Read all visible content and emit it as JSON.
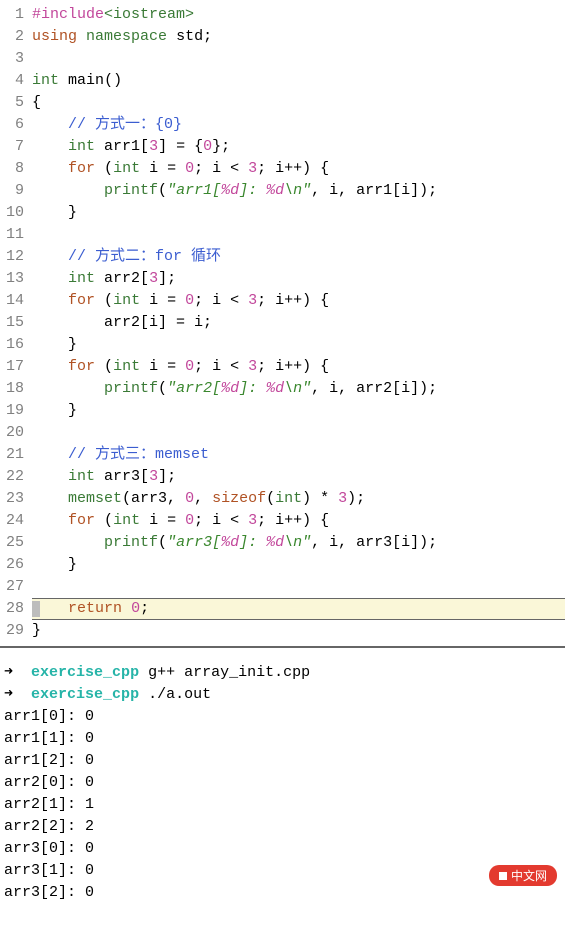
{
  "code": {
    "lines": [
      {
        "n": "1",
        "tokens": [
          [
            "pp",
            "#include"
          ],
          [
            "hdr",
            "<iostream>"
          ]
        ]
      },
      {
        "n": "2",
        "tokens": [
          [
            "kw",
            "using"
          ],
          [
            "op",
            " "
          ],
          [
            "type",
            "namespace"
          ],
          [
            "op",
            " "
          ],
          [
            "id",
            "std"
          ],
          [
            "op",
            ";"
          ]
        ]
      },
      {
        "n": "3",
        "tokens": []
      },
      {
        "n": "4",
        "tokens": [
          [
            "type",
            "int"
          ],
          [
            "op",
            " "
          ],
          [
            "id",
            "main"
          ],
          [
            "op",
            "()"
          ]
        ]
      },
      {
        "n": "5",
        "tokens": [
          [
            "op",
            "{"
          ]
        ]
      },
      {
        "n": "6",
        "tokens": [
          [
            "op",
            "    "
          ],
          [
            "cm",
            "// 方式一：{0}"
          ]
        ]
      },
      {
        "n": "7",
        "tokens": [
          [
            "op",
            "    "
          ],
          [
            "type",
            "int"
          ],
          [
            "op",
            " arr1["
          ],
          [
            "num",
            "3"
          ],
          [
            "op",
            "] = {"
          ],
          [
            "num",
            "0"
          ],
          [
            "op",
            "};"
          ]
        ]
      },
      {
        "n": "8",
        "tokens": [
          [
            "op",
            "    "
          ],
          [
            "kw",
            "for"
          ],
          [
            "op",
            " ("
          ],
          [
            "type",
            "int"
          ],
          [
            "op",
            " i = "
          ],
          [
            "num",
            "0"
          ],
          [
            "op",
            "; i < "
          ],
          [
            "num",
            "3"
          ],
          [
            "op",
            "; i++) {"
          ]
        ]
      },
      {
        "n": "9",
        "tokens": [
          [
            "op",
            "        "
          ],
          [
            "fn",
            "printf"
          ],
          [
            "op",
            "("
          ],
          [
            "str",
            "\"arr1["
          ],
          [
            "fmt",
            "%d"
          ],
          [
            "str",
            "]: "
          ],
          [
            "fmt",
            "%d"
          ],
          [
            "str",
            "\\n\""
          ],
          [
            "op",
            ", i, arr1[i]);"
          ]
        ]
      },
      {
        "n": "10",
        "tokens": [
          [
            "op",
            "    }"
          ]
        ]
      },
      {
        "n": "11",
        "tokens": []
      },
      {
        "n": "12",
        "tokens": [
          [
            "op",
            "    "
          ],
          [
            "cm",
            "// 方式二：for 循环"
          ]
        ]
      },
      {
        "n": "13",
        "tokens": [
          [
            "op",
            "    "
          ],
          [
            "type",
            "int"
          ],
          [
            "op",
            " arr2["
          ],
          [
            "num",
            "3"
          ],
          [
            "op",
            "];"
          ]
        ]
      },
      {
        "n": "14",
        "tokens": [
          [
            "op",
            "    "
          ],
          [
            "kw",
            "for"
          ],
          [
            "op",
            " ("
          ],
          [
            "type",
            "int"
          ],
          [
            "op",
            " i = "
          ],
          [
            "num",
            "0"
          ],
          [
            "op",
            "; i < "
          ],
          [
            "num",
            "3"
          ],
          [
            "op",
            "; i++) {"
          ]
        ]
      },
      {
        "n": "15",
        "tokens": [
          [
            "op",
            "        arr2[i] = i;"
          ]
        ]
      },
      {
        "n": "16",
        "tokens": [
          [
            "op",
            "    }"
          ]
        ]
      },
      {
        "n": "17",
        "tokens": [
          [
            "op",
            "    "
          ],
          [
            "kw",
            "for"
          ],
          [
            "op",
            " ("
          ],
          [
            "type",
            "int"
          ],
          [
            "op",
            " i = "
          ],
          [
            "num",
            "0"
          ],
          [
            "op",
            "; i < "
          ],
          [
            "num",
            "3"
          ],
          [
            "op",
            "; i++) {"
          ]
        ]
      },
      {
        "n": "18",
        "tokens": [
          [
            "op",
            "        "
          ],
          [
            "fn",
            "printf"
          ],
          [
            "op",
            "("
          ],
          [
            "str",
            "\"arr2["
          ],
          [
            "fmt",
            "%d"
          ],
          [
            "str",
            "]: "
          ],
          [
            "fmt",
            "%d"
          ],
          [
            "str",
            "\\n\""
          ],
          [
            "op",
            ", i, arr2[i]);"
          ]
        ]
      },
      {
        "n": "19",
        "tokens": [
          [
            "op",
            "    }"
          ]
        ]
      },
      {
        "n": "20",
        "tokens": []
      },
      {
        "n": "21",
        "tokens": [
          [
            "op",
            "    "
          ],
          [
            "cm",
            "// 方式三：memset"
          ]
        ]
      },
      {
        "n": "22",
        "tokens": [
          [
            "op",
            "    "
          ],
          [
            "type",
            "int"
          ],
          [
            "op",
            " arr3["
          ],
          [
            "num",
            "3"
          ],
          [
            "op",
            "];"
          ]
        ]
      },
      {
        "n": "23",
        "tokens": [
          [
            "op",
            "    "
          ],
          [
            "fn",
            "memset"
          ],
          [
            "op",
            "(arr3, "
          ],
          [
            "num",
            "0"
          ],
          [
            "op",
            ", "
          ],
          [
            "kw",
            "sizeof"
          ],
          [
            "op",
            "("
          ],
          [
            "type",
            "int"
          ],
          [
            "op",
            ") * "
          ],
          [
            "num",
            "3"
          ],
          [
            "op",
            ");"
          ]
        ]
      },
      {
        "n": "24",
        "tokens": [
          [
            "op",
            "    "
          ],
          [
            "kw",
            "for"
          ],
          [
            "op",
            " ("
          ],
          [
            "type",
            "int"
          ],
          [
            "op",
            " i = "
          ],
          [
            "num",
            "0"
          ],
          [
            "op",
            "; i < "
          ],
          [
            "num",
            "3"
          ],
          [
            "op",
            "; i++) {"
          ]
        ]
      },
      {
        "n": "25",
        "tokens": [
          [
            "op",
            "        "
          ],
          [
            "fn",
            "printf"
          ],
          [
            "op",
            "("
          ],
          [
            "str",
            "\"arr3["
          ],
          [
            "fmt",
            "%d"
          ],
          [
            "str",
            "]: "
          ],
          [
            "fmt",
            "%d"
          ],
          [
            "str",
            "\\n\""
          ],
          [
            "op",
            ", i, arr3[i]);"
          ]
        ]
      },
      {
        "n": "26",
        "tokens": [
          [
            "op",
            "    }"
          ]
        ]
      },
      {
        "n": "27",
        "tokens": []
      },
      {
        "n": "28",
        "cursor": true,
        "tokens": [
          [
            "op",
            "    "
          ],
          [
            "kw",
            "return"
          ],
          [
            "op",
            " "
          ],
          [
            "num",
            "0"
          ],
          [
            "op",
            ";"
          ]
        ]
      },
      {
        "n": "29",
        "tokens": [
          [
            "op",
            "}"
          ]
        ]
      }
    ]
  },
  "terminal": {
    "arrow": "➜",
    "prompt": "exercise_cpp",
    "commands": [
      "g++ array_init.cpp",
      "./a.out"
    ],
    "output": [
      "arr1[0]: 0",
      "arr1[1]: 0",
      "arr1[2]: 0",
      "arr2[0]: 0",
      "arr2[1]: 1",
      "arr2[2]: 2",
      "arr3[0]: 0",
      "arr3[1]: 0",
      "arr3[2]: 0"
    ]
  },
  "watermark": {
    "text": "中文网"
  }
}
